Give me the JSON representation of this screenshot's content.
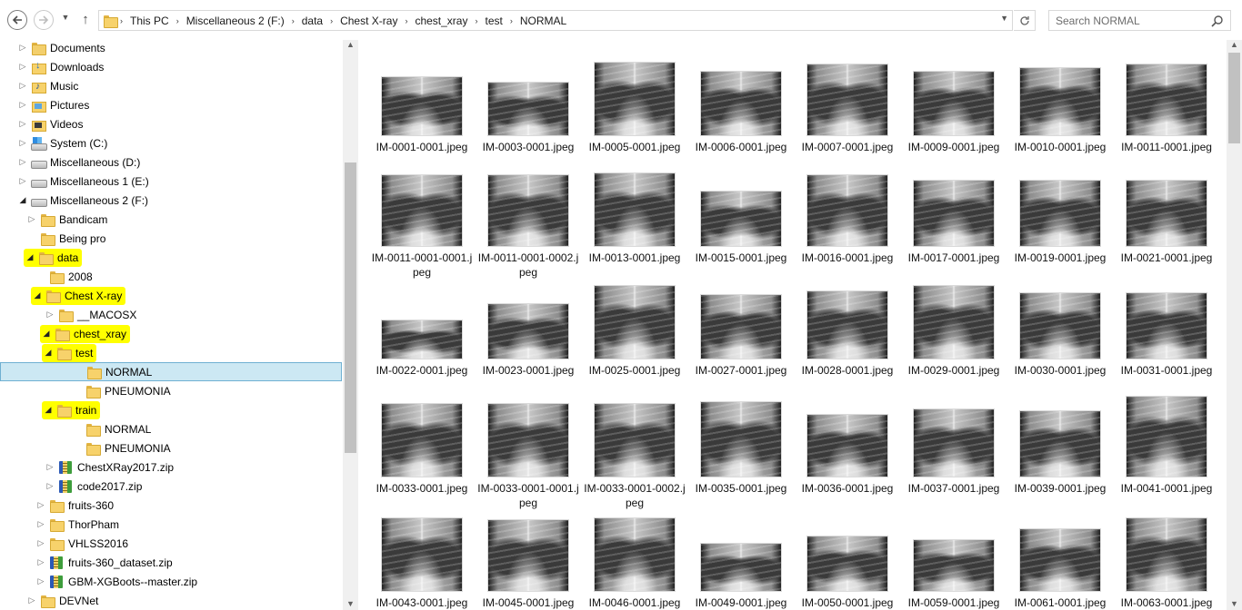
{
  "toolbar": {
    "path": [
      "This PC",
      "Miscellaneous 2 (F:)",
      "data",
      "Chest X-ray",
      "chest_xray",
      "test",
      "NORMAL"
    ],
    "search_placeholder": "Search NORMAL"
  },
  "tree": [
    {
      "label": "Documents",
      "level": 1,
      "arrow": "▷",
      "icon": "documents-folder-icon",
      "highlight": false,
      "selected": false
    },
    {
      "label": "Downloads",
      "level": 1,
      "arrow": "▷",
      "icon": "downloads-folder-icon",
      "highlight": false,
      "selected": false
    },
    {
      "label": "Music",
      "level": 1,
      "arrow": "▷",
      "icon": "music-folder-icon",
      "highlight": false,
      "selected": false
    },
    {
      "label": "Pictures",
      "level": 1,
      "arrow": "▷",
      "icon": "pictures-folder-icon",
      "highlight": false,
      "selected": false
    },
    {
      "label": "Videos",
      "level": 1,
      "arrow": "▷",
      "icon": "videos-folder-icon",
      "highlight": false,
      "selected": false
    },
    {
      "label": "System (C:)",
      "level": 1,
      "arrow": "▷",
      "icon": "system-drive-icon",
      "highlight": false,
      "selected": false
    },
    {
      "label": "Miscellaneous  (D:)",
      "level": 1,
      "arrow": "▷",
      "icon": "drive-icon",
      "highlight": false,
      "selected": false
    },
    {
      "label": "Miscellaneous 1 (E:)",
      "level": 1,
      "arrow": "▷",
      "icon": "drive-icon",
      "highlight": false,
      "selected": false
    },
    {
      "label": "Miscellaneous 2 (F:)",
      "level": 1,
      "arrow": "◢",
      "icon": "drive-icon",
      "highlight": false,
      "selected": false
    },
    {
      "label": "Bandicam",
      "level": 2,
      "arrow": "▷",
      "icon": "folder-icon",
      "highlight": false,
      "selected": false
    },
    {
      "label": "Being pro",
      "level": 2,
      "arrow": "",
      "icon": "folder-icon",
      "highlight": false,
      "selected": false
    },
    {
      "label": "data",
      "level": 2,
      "arrow": "◢",
      "icon": "folder-icon",
      "highlight": true,
      "selected": false
    },
    {
      "label": "2008",
      "level": 3,
      "arrow": "",
      "icon": "folder-icon",
      "highlight": false,
      "selected": false
    },
    {
      "label": "Chest X-ray",
      "level": 3,
      "arrow": "◢",
      "icon": "folder-icon",
      "highlight": true,
      "selected": false
    },
    {
      "label": "__MACOSX",
      "level": 4,
      "arrow": "▷",
      "icon": "folder-icon",
      "highlight": false,
      "selected": false
    },
    {
      "label": "chest_xray",
      "level": 4,
      "arrow": "◢",
      "icon": "folder-icon",
      "highlight": true,
      "selected": false
    },
    {
      "label": "test",
      "level": 5,
      "arrow": "◢",
      "icon": "folder-icon",
      "highlight": true,
      "selected": false
    },
    {
      "label": "NORMAL",
      "level": 6,
      "arrow": "",
      "icon": "folder-icon",
      "highlight": false,
      "selected": true
    },
    {
      "label": "PNEUMONIA",
      "level": 6,
      "arrow": "",
      "icon": "folder-icon",
      "highlight": false,
      "selected": false
    },
    {
      "label": "train",
      "level": 5,
      "arrow": "◢",
      "icon": "folder-icon",
      "highlight": true,
      "selected": false
    },
    {
      "label": "NORMAL",
      "level": 6,
      "arrow": "",
      "icon": "folder-icon",
      "highlight": false,
      "selected": false
    },
    {
      "label": "PNEUMONIA",
      "level": 6,
      "arrow": "",
      "icon": "folder-icon",
      "highlight": false,
      "selected": false
    },
    {
      "label": "ChestXRay2017.zip",
      "level": 4,
      "arrow": "▷",
      "icon": "zip-archive-icon",
      "highlight": false,
      "selected": false
    },
    {
      "label": "code2017.zip",
      "level": 4,
      "arrow": "▷",
      "icon": "zip-archive-icon",
      "highlight": false,
      "selected": false
    },
    {
      "label": "fruits-360",
      "level": 3,
      "arrow": "▷",
      "icon": "folder-icon",
      "highlight": false,
      "selected": false
    },
    {
      "label": "ThorPham",
      "level": 3,
      "arrow": "▷",
      "icon": "folder-icon",
      "highlight": false,
      "selected": false
    },
    {
      "label": "VHLSS2016",
      "level": 3,
      "arrow": "▷",
      "icon": "folder-icon",
      "highlight": false,
      "selected": false
    },
    {
      "label": "fruits-360_dataset.zip",
      "level": 3,
      "arrow": "▷",
      "icon": "zip-archive-icon",
      "highlight": false,
      "selected": false
    },
    {
      "label": "GBM-XGBoots--master.zip",
      "level": 3,
      "arrow": "▷",
      "icon": "zip-archive-icon",
      "highlight": false,
      "selected": false
    },
    {
      "label": "DEVNet",
      "level": 2,
      "arrow": "▷",
      "icon": "folder-icon",
      "highlight": false,
      "selected": false
    }
  ],
  "files": [
    [
      "IM-0001-0001.jpeg",
      "IM-0003-0001.jpeg",
      "IM-0005-0001.jpeg",
      "IM-0006-0001.jpeg",
      "IM-0007-0001.jpeg",
      "IM-0009-0001.jpeg",
      "IM-0010-0001.jpeg",
      "IM-0011-0001.jpeg"
    ],
    [
      "IM-0011-0001-0001.jpeg",
      "IM-0011-0001-0002.jpeg",
      "IM-0013-0001.jpeg",
      "IM-0015-0001.jpeg",
      "IM-0016-0001.jpeg",
      "IM-0017-0001.jpeg",
      "IM-0019-0001.jpeg",
      "IM-0021-0001.jpeg"
    ],
    [
      "IM-0022-0001.jpeg",
      "IM-0023-0001.jpeg",
      "IM-0025-0001.jpeg",
      "IM-0027-0001.jpeg",
      "IM-0028-0001.jpeg",
      "IM-0029-0001.jpeg",
      "IM-0030-0001.jpeg",
      "IM-0031-0001.jpeg"
    ],
    [
      "IM-0033-0001.jpeg",
      "IM-0033-0001-0001.jpeg",
      "IM-0033-0001-0002.jpeg",
      "IM-0035-0001.jpeg",
      "IM-0036-0001.jpeg",
      "IM-0037-0001.jpeg",
      "IM-0039-0001.jpeg",
      "IM-0041-0001.jpeg"
    ],
    [
      "IM-0043-0001.jpeg",
      "IM-0045-0001.jpeg",
      "IM-0046-0001.jpeg",
      "IM-0049-0001.jpeg",
      "IM-0050-0001.jpeg",
      "IM-0059-0001.jpeg",
      "IM-0061-0001.jpeg",
      "IM-0063-0001.jpeg"
    ]
  ]
}
